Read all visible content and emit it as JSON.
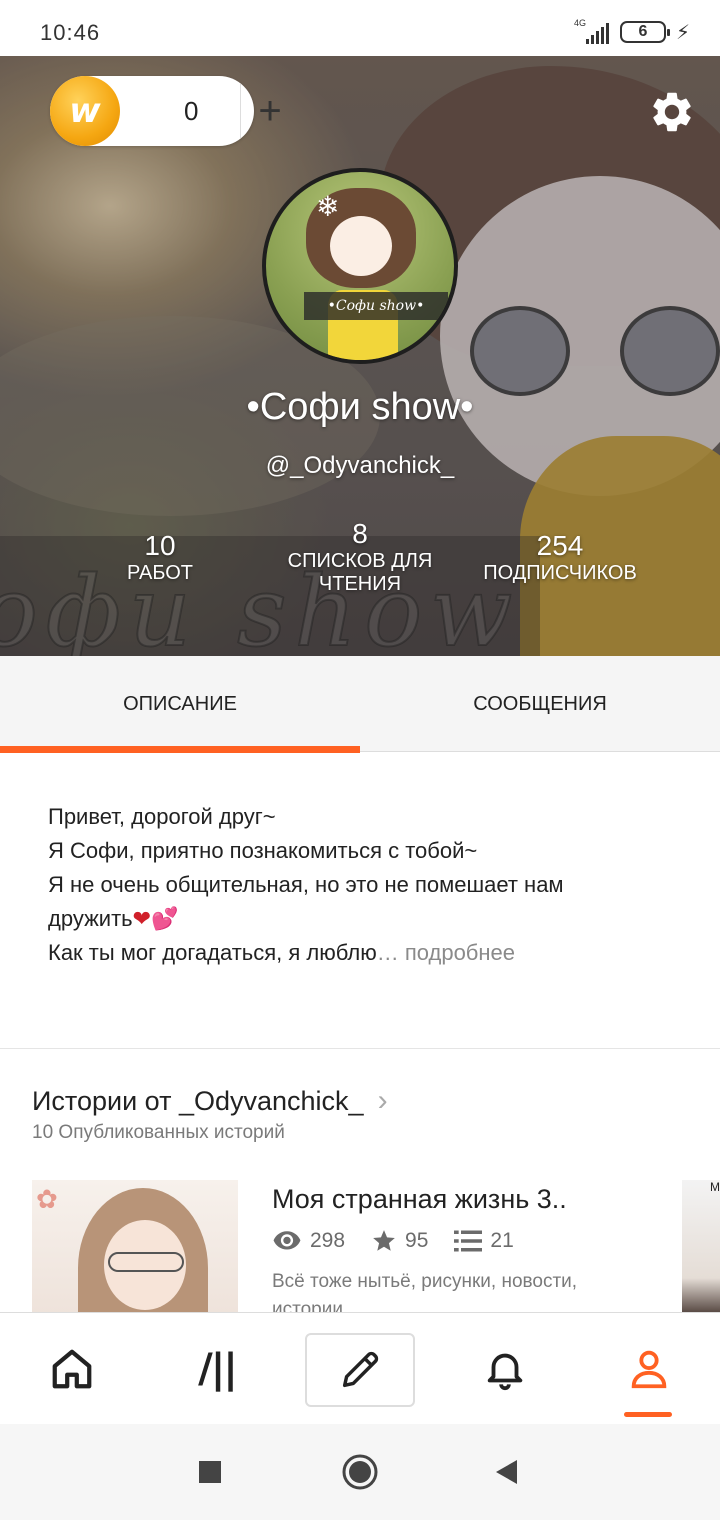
{
  "status_bar": {
    "time": "10:46",
    "network": "4G",
    "battery": "6"
  },
  "header": {
    "coins": "0",
    "coin_symbol": "w",
    "add_label": "+",
    "avatar_label": "•Софи show•",
    "display_name": "•Софи show•",
    "username": "@_Odyvanchick_",
    "watermark": "офи show",
    "stats": {
      "works": {
        "value": "10",
        "label": "РАБОТ"
      },
      "reading_lists": {
        "value": "8",
        "label": "СПИСКОВ ДЛЯ ЧТЕНИЯ"
      },
      "followers": {
        "value": "254",
        "label": "ПОДПИСЧИКОВ"
      }
    }
  },
  "tabs": [
    {
      "label": "ОПИСАНИЕ",
      "active": true
    },
    {
      "label": "СООБЩЕНИЯ",
      "active": false
    }
  ],
  "description": {
    "line1": "Привет, дорогой друг~",
    "line2": "Я Софи, приятно познакомиться с тобой~",
    "line3": "Я не очень общительная, но это не помешает нам",
    "line4": "дружить",
    "heart1": "❤",
    "heart2": "💕",
    "line5": "Как ты мог догадаться, я люблю",
    "more": "… подробнее"
  },
  "stories": {
    "title": "Истории от _Odyvanchick_",
    "subtitle": "10 Опубликованных историй",
    "items": [
      {
        "title": "Моя странная жизнь 3..",
        "views": "298",
        "votes": "95",
        "parts": "21",
        "description": "Всё тоже нытьё, рисунки, новости, истории..."
      }
    ],
    "peek_label": "M"
  },
  "colors": {
    "accent": "#ff6122",
    "coin": "#f5a712"
  }
}
